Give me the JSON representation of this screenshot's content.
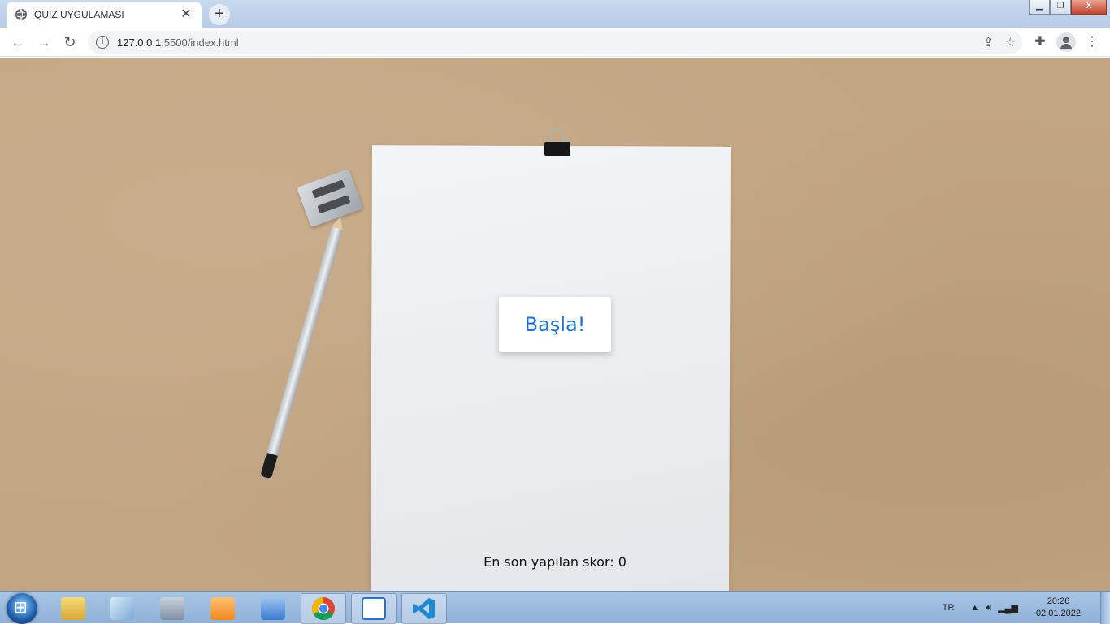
{
  "browser": {
    "tab_title": "QUİZ UYGULAMASI",
    "tab_close": "✕",
    "new_tab": "+",
    "url_host": "127.0.0.1",
    "url_rest": ":5500/index.html",
    "window_controls": {
      "minimize": "▁",
      "maximize": "❐",
      "close": "X"
    }
  },
  "quiz": {
    "start_button": "Başla!",
    "last_score": "En son yapılan skor: 0"
  },
  "taskbar": {
    "items": [
      {
        "name": "explorer",
        "color": "#e8c34a"
      },
      {
        "name": "notepad",
        "color": "#7aa9d6"
      },
      {
        "name": "calculator",
        "color": "#7f8fa3"
      },
      {
        "name": "media-player",
        "color": "#f08a1f"
      },
      {
        "name": "remote-desktop",
        "color": "#3b7bd0"
      },
      {
        "name": "chrome",
        "color": "#db4437"
      },
      {
        "name": "document",
        "color": "#2f6fc2"
      },
      {
        "name": "vscode",
        "color": "#1f8ad2"
      }
    ],
    "language": "TR",
    "time": "20:26",
    "date": "02.01.2022"
  },
  "colors": {
    "accent": "#1a73d9"
  }
}
